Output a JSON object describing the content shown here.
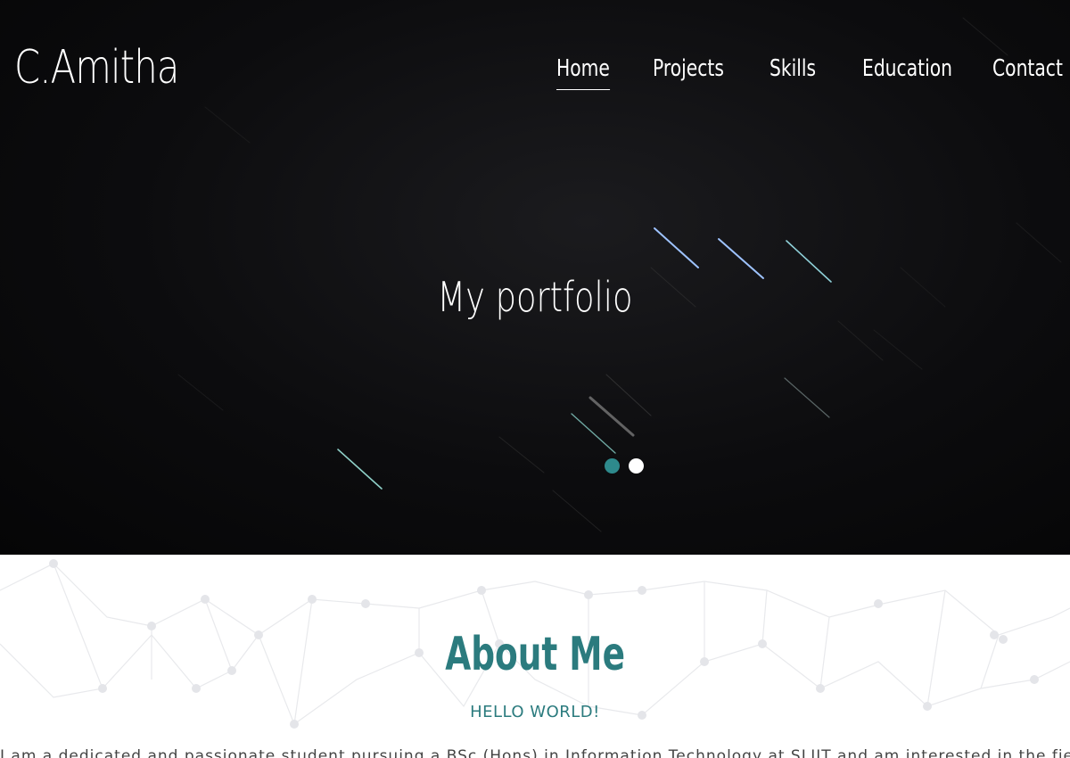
{
  "header": {
    "logo": "C.Amitha",
    "nav": [
      {
        "label": "Home",
        "active": true
      },
      {
        "label": "Projects",
        "active": false
      },
      {
        "label": "Skills",
        "active": false
      },
      {
        "label": "Education",
        "active": false
      },
      {
        "label": "Contact",
        "active": false
      }
    ]
  },
  "hero": {
    "title": "My portfolio",
    "slides": {
      "count": 2,
      "active": 1
    }
  },
  "about": {
    "title": "About Me",
    "subtitle": "HELLO WORLD!",
    "text": "I am a dedicated and passionate student pursuing a BSc (Hons) in Information Technology at SLIIT and am interested in the fields of Information Technology. Pa"
  },
  "colors": {
    "accent": "#2b7b7e",
    "dot_active": "#2e8a8c",
    "hero_bg": "#0c0c0e"
  }
}
